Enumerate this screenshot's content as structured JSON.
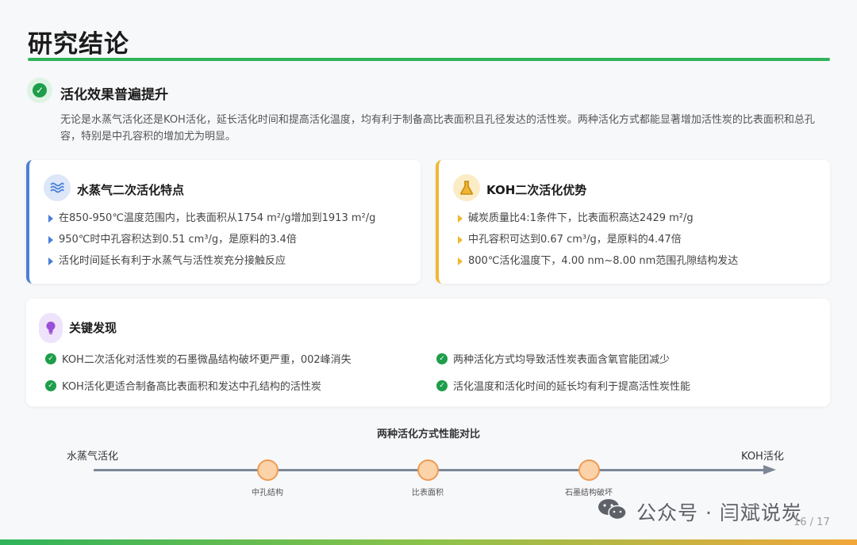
{
  "page": {
    "title": "研究结论",
    "page_number": "16 / 17"
  },
  "summary": {
    "icon": "check-circle-icon",
    "heading": "活化效果普遍提升",
    "body": "无论是水蒸气活化还是KOH活化，延长活化时间和提高活化温度，均有利于制备高比表面积且孔径发达的活性炭。两种活化方式都能显著增加活性炭的比表面积和总孔容，特别是中孔容积的增加尤为明显。"
  },
  "steam_card": {
    "icon": "water-waves-icon",
    "title": "水蒸气二次活化特点",
    "accent": "#4a7fd6",
    "items": [
      "在850-950℃温度范围内，比表面积从1754 m²/g增加到1913 m²/g",
      "950℃时中孔容积达到0.51 cm³/g，是原料的3.4倍",
      "活化时间延长有利于水蒸气与活性炭充分接触反应"
    ]
  },
  "koh_card": {
    "icon": "flask-icon",
    "title": "KOH二次活化优势",
    "accent": "#f0b732",
    "items": [
      "碱炭质量比4:1条件下，比表面积高达2429 m²/g",
      "中孔容积可达到0.67 cm³/g，是原料的4.47倍",
      "800℃活化温度下，4.00 nm~8.00 nm范围孔隙结构发达"
    ]
  },
  "findings": {
    "icon": "lightbulb-icon",
    "title": "关键发现",
    "items": [
      "KOH二次活化对活性炭的石墨微晶结构破坏更严重，002峰消失",
      "两种活化方式均导致活性炭表面含氧官能团减少",
      "KOH活化更适合制备高比表面积和发达中孔结构的活性炭",
      "活化温度和活化时间的延长均有利于提高活性炭性能"
    ]
  },
  "comparison": {
    "title": "两种活化方式性能对比",
    "left_label": "水蒸气活化",
    "right_label": "KOH活化",
    "nodes": [
      "中孔结构",
      "比表面积",
      "石墨结构破坏"
    ]
  },
  "watermark": {
    "text": "公众号 · 闫斌说炭",
    "icon": "wechat-icon"
  },
  "colors": {
    "primary": "#2fb35a",
    "node_fill": "#fcd3a8",
    "node_stroke": "#ee9b54"
  }
}
